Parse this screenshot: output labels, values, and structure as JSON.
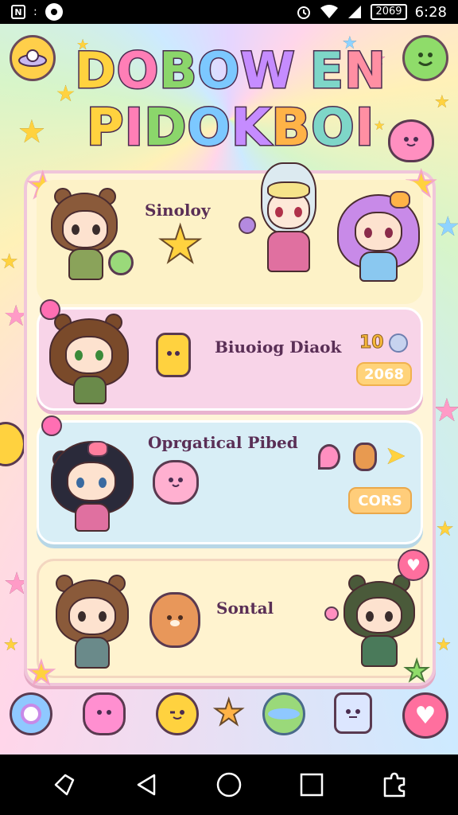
{
  "status": {
    "time": "6:28",
    "battery": "2069"
  },
  "title": {
    "line1": [
      "D",
      "O",
      "B",
      "O",
      "W",
      " ",
      "E",
      "N"
    ],
    "line2": [
      "P",
      "I",
      "D",
      "O",
      "K",
      "B",
      "O",
      "I"
    ],
    "colors": [
      "#ffd23f",
      "#ff7eb6",
      "#8bd66b",
      "#7cc8ff",
      "#c58cff",
      "#ffb347",
      "#7ed6c8",
      "#ff8fa3"
    ]
  },
  "cards": [
    {
      "label": "Sinoloy"
    },
    {
      "label": "Biuoiog Diaok",
      "counter": "10",
      "badge": "2068"
    },
    {
      "label": "Oprgatical Pibed",
      "badge": "CORS"
    },
    {
      "label": "Sontal"
    }
  ],
  "icons": {
    "top_left": "ufo-icon",
    "top_right": "smiley-icon",
    "bottom": [
      "balloon-icon",
      "pink-monster-icon",
      "yellow-blob-icon",
      "star-icon",
      "planet-icon",
      "robot-icon",
      "heart-icon"
    ],
    "nav": [
      "back-icon",
      "triangle-back-icon",
      "home-icon",
      "recents-icon",
      "puzzle-icon"
    ]
  }
}
